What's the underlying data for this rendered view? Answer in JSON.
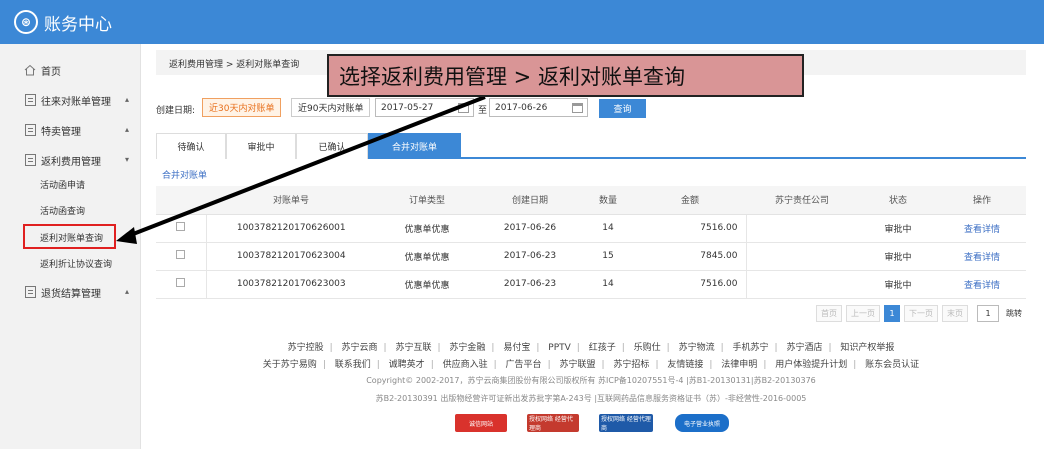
{
  "app": {
    "title": "账务中心",
    "logo_glyph": "⊛"
  },
  "sidebar": {
    "items": [
      {
        "label": "首页",
        "icon": "home-icon"
      },
      {
        "label": "往来对账单管理",
        "arrow": "▴",
        "icon": "document-icon"
      },
      {
        "label": "特卖管理",
        "arrow": "▴",
        "icon": "document-icon"
      },
      {
        "label": "返利费用管理",
        "arrow": "▾",
        "icon": "document-icon"
      },
      {
        "label": "退货结算管理",
        "arrow": "▴",
        "icon": "document-icon"
      }
    ],
    "subitems": [
      "活动函申请",
      "活动函查询",
      "返利对账单查询",
      "返利折让协议查询"
    ]
  },
  "breadcrumb": "返利费用管理 > 返利对账单查询",
  "callout": "选择返利费用管理 > 返利对账单查询",
  "filter": {
    "label": "创建日期:",
    "range_30": "近30天内对账单",
    "range_90": "近90天内对账单",
    "start_date": "2017-05-27",
    "to": "至",
    "end_date": "2017-06-26",
    "query": "查询"
  },
  "tabs": [
    "待确认",
    "审批中",
    "已确认",
    "合并对账单"
  ],
  "merge_link": "合并对账单",
  "table": {
    "headers": [
      "",
      "对账单号",
      "订单类型",
      "创建日期",
      "数量",
      "金额",
      "苏宁责任公司",
      "状态",
      "操作"
    ],
    "rows": [
      [
        "",
        "1003782120170626001",
        "优惠单优惠",
        "2017-06-26",
        "14",
        "7516.00",
        "",
        "审批中",
        "查看详情"
      ],
      [
        "",
        "1003782120170623004",
        "优惠单优惠",
        "2017-06-23",
        "15",
        "7845.00",
        "",
        "审批中",
        "查看详情"
      ],
      [
        "",
        "1003782120170623003",
        "优惠单优惠",
        "2017-06-23",
        "14",
        "7516.00",
        "",
        "审批中",
        "查看详情"
      ]
    ]
  },
  "pager": {
    "first": "首页",
    "prev": "上一页",
    "current": "1",
    "next": "下一页",
    "last": "末页",
    "page_input": "1",
    "go": "跳转"
  },
  "footer": {
    "links1": [
      "苏宁控股",
      "苏宁云商",
      "苏宁互联",
      "苏宁金融",
      "易付宝",
      "PPTV",
      "红孩子",
      "乐购仕",
      "苏宁物流",
      "手机苏宁",
      "苏宁酒店",
      "知识产权举报"
    ],
    "links2": [
      "关于苏宁易购",
      "联系我们",
      "诚聘英才",
      "供应商入驻",
      "广告平台",
      "苏宁联盟",
      "苏宁招标",
      "友情链接",
      "法律申明",
      "用户体验提升计划",
      "账东会员认证"
    ],
    "copyright": "Copyright© 2002-2017，苏宁云商集团股份有限公司版权所有 苏ICP备10207551号-4 |苏B1-20130131|苏B2-20130376",
    "license": "苏B2-20130391 出版物经营许可证新出发苏批字第A-243号 |互联网药品信息服务资格证书（苏）-非经营性-2016-0005",
    "badges": [
      "诚信网站",
      "授权网络 经营代理商",
      "授权网络 经营代理商",
      "电子营业执照"
    ]
  },
  "colors": {
    "brand": "#3c88d6",
    "highlight": "#e02020",
    "callout_bg": "#d99596",
    "active_range": "#e8711e"
  }
}
